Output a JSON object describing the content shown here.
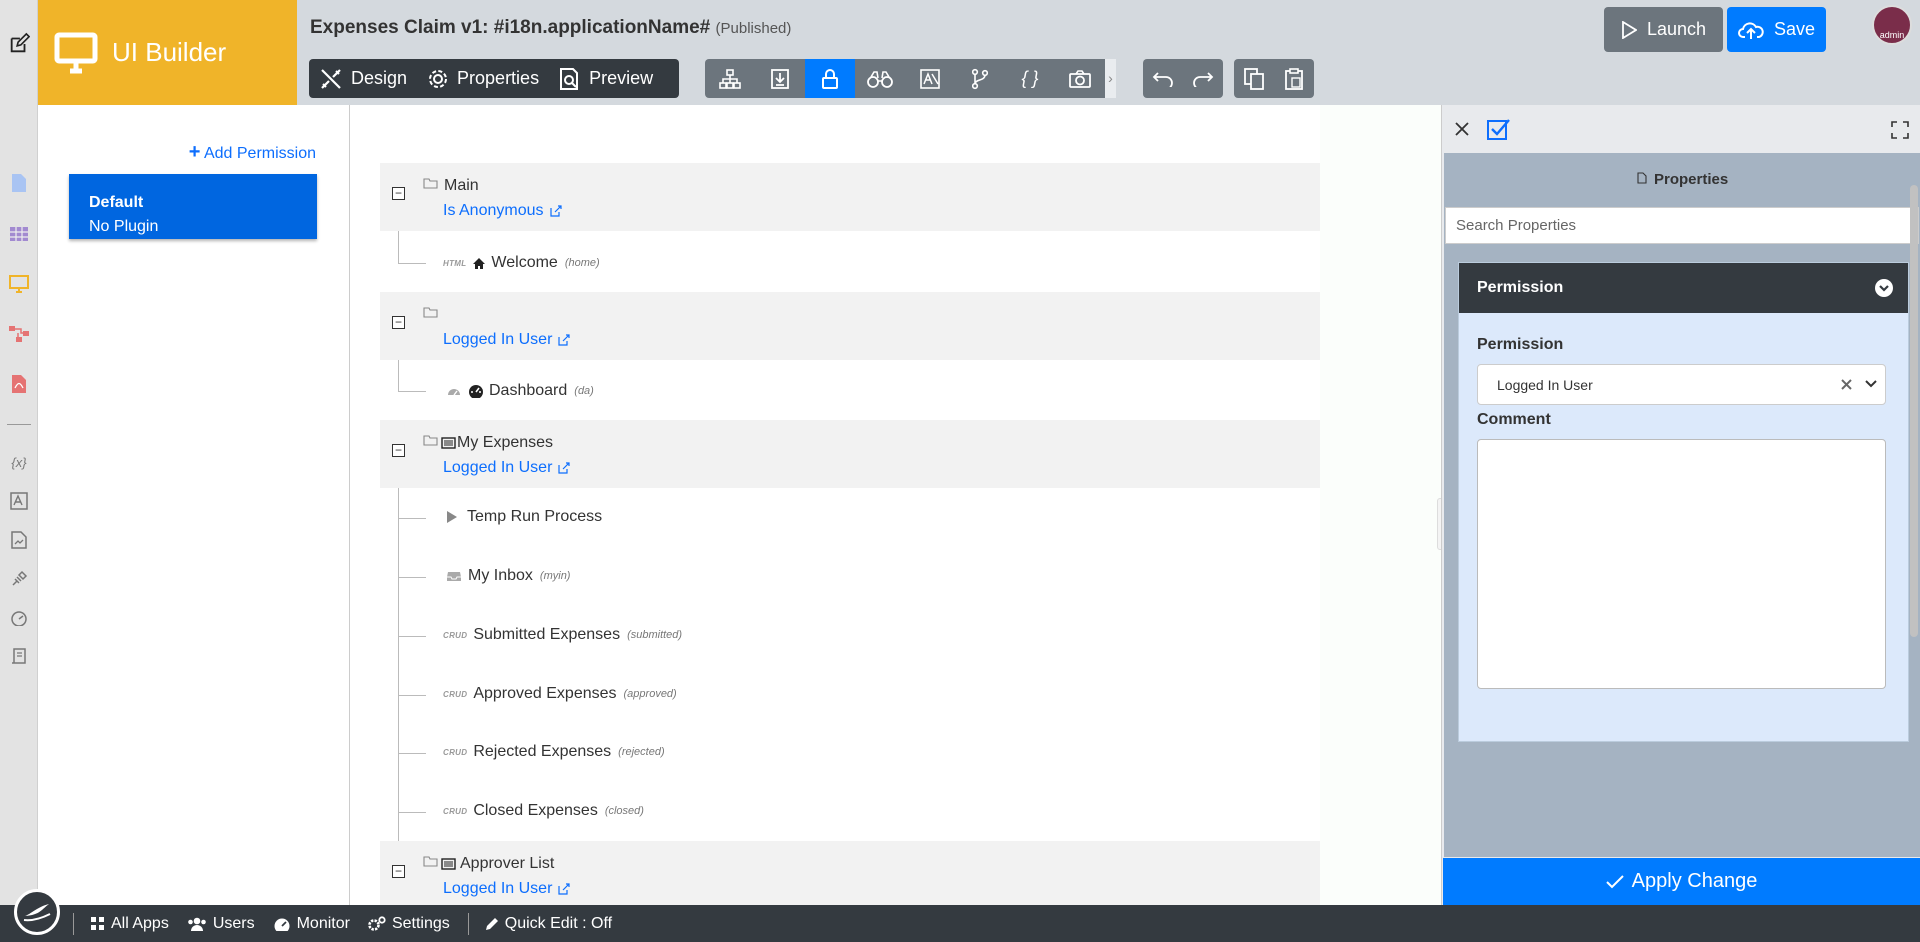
{
  "brand": {
    "title": "UI Builder"
  },
  "header": {
    "app_title": "Expenses Claim v1: #i18n.applicationName#",
    "status": "(Published)",
    "launch_label": "Launch",
    "save_label": "Save",
    "user": "admin",
    "view_tabs": [
      "Design",
      "Properties",
      "Preview"
    ],
    "tool_icons": [
      "sitemap-icon",
      "import-icon",
      "lock-icon",
      "binoculars-icon",
      "i18n-icon",
      "branch-icon",
      "braces-icon",
      "camera-icon"
    ]
  },
  "permissions": {
    "add_label": "Add Permission",
    "items": [
      {
        "name": "Default",
        "plugin": "No Plugin"
      }
    ]
  },
  "tree": {
    "categories": [
      {
        "name": "Main",
        "permission": "Is Anonymous"
      },
      {
        "name": "",
        "permission": "Logged In User"
      },
      {
        "name": "My Expenses",
        "permission": "Logged In User"
      },
      {
        "name": "Approver List",
        "permission": "Logged In User"
      }
    ],
    "menus": [
      {
        "type": "HTML",
        "label": "Welcome",
        "id": "(home)"
      },
      {
        "type": "",
        "label": "Dashboard",
        "id": "(da)"
      },
      {
        "type": "",
        "label": "Temp Run Process",
        "id": ""
      },
      {
        "type": "",
        "label": "My Inbox",
        "id": "(myin)"
      },
      {
        "type": "CRUD",
        "label": "Submitted Expenses",
        "id": "(submitted)"
      },
      {
        "type": "CRUD",
        "label": "Approved Expenses",
        "id": "(approved)"
      },
      {
        "type": "CRUD",
        "label": "Rejected Expenses",
        "id": "(rejected)"
      },
      {
        "type": "CRUD",
        "label": "Closed Expenses",
        "id": "(closed)"
      }
    ]
  },
  "properties": {
    "title": "Properties",
    "search_placeholder": "Search Properties",
    "section_title": "Permission",
    "permission_label": "Permission",
    "permission_value": "Logged In User",
    "comment_label": "Comment",
    "comment_value": "",
    "apply_label": "Apply Change"
  },
  "footer": {
    "items": [
      "All Apps",
      "Users",
      "Monitor",
      "Settings"
    ],
    "quick_edit": "Quick Edit : Off"
  },
  "colors": {
    "brand": "#f0b429",
    "primary": "#007bff",
    "dark": "#343a40"
  }
}
